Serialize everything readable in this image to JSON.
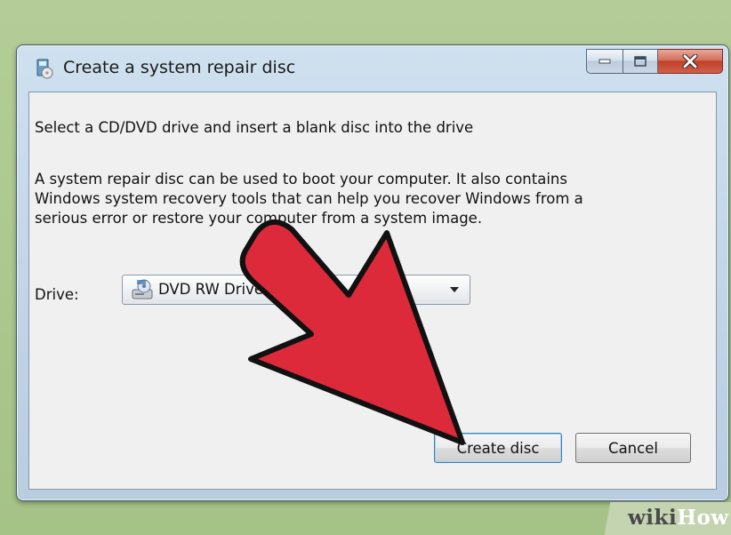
{
  "window": {
    "title": "Create a system repair disc",
    "icon": "repair-disc-icon"
  },
  "caption_buttons": {
    "minimize": "minimize-icon",
    "maximize": "maximize-icon",
    "close": "close-icon"
  },
  "content": {
    "heading": "Select a CD/DVD drive and insert a blank disc into the drive",
    "paragraph_line1": "A system repair disc can be used to boot your computer. It also contains",
    "paragraph_line2": "Windows system recovery tools that can help you recover Windows from a",
    "paragraph_line3": "serious error or restore your computer from a system image."
  },
  "drive": {
    "label": "Drive:",
    "selected": "DVD RW Drive (",
    "icon": "dvd-drive-icon"
  },
  "buttons": {
    "create": "Create disc",
    "cancel": "Cancel"
  },
  "watermark": {
    "part1": "wiki",
    "part2": "How"
  },
  "colors": {
    "arrow_fill": "#dd2a3a",
    "arrow_outline": "#111111",
    "window_frame": "#c0d4e6",
    "close_button": "#c04028"
  }
}
